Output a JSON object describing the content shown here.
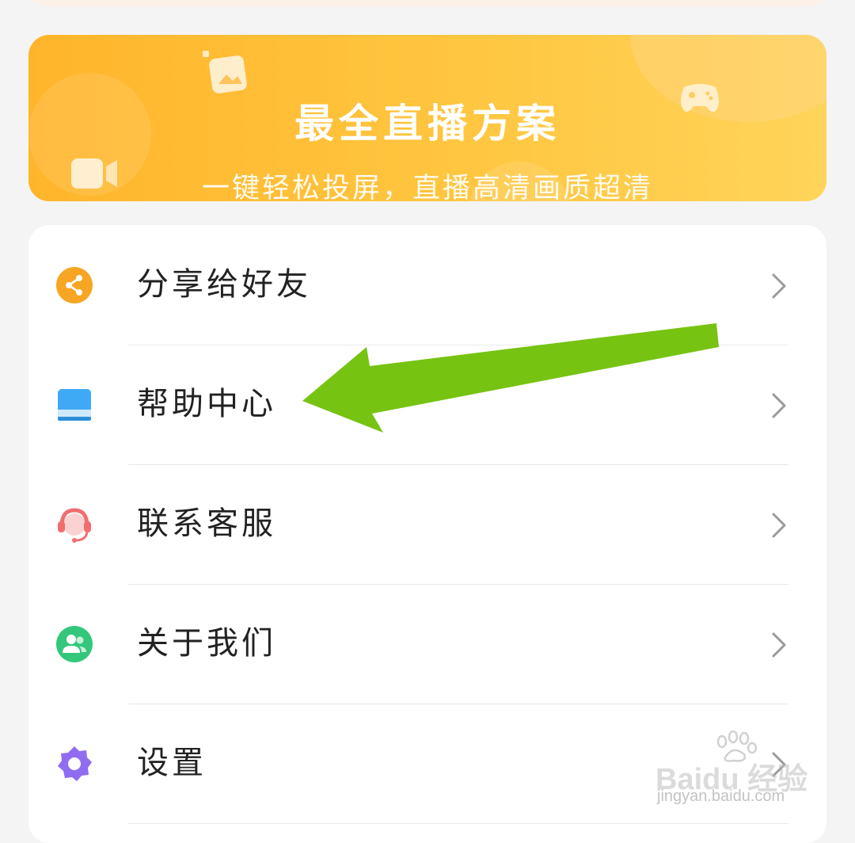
{
  "banner": {
    "title": "最全直播方案",
    "subtitle": "一键轻松投屏，直播高清画质超清"
  },
  "menu": {
    "items": [
      {
        "label": "分享给好友",
        "icon": "share-icon",
        "icon_color": "#f6a623"
      },
      {
        "label": "帮助中心",
        "icon": "book-icon",
        "icon_color": "#3fa9f5"
      },
      {
        "label": "联系客服",
        "icon": "headset-icon",
        "icon_color": "#f06e6e"
      },
      {
        "label": "关于我们",
        "icon": "people-icon",
        "icon_color": "#34c77b"
      },
      {
        "label": "设置",
        "icon": "gear-icon",
        "icon_color": "#8f6cf0"
      }
    ]
  },
  "annotation": {
    "arrow_color": "#76c312"
  },
  "watermark": {
    "logo": "Baidu 经验",
    "url": "jingyan.baidu.com"
  },
  "colors": {
    "banner_start": "#ffb52b",
    "banner_end": "#ffd45a",
    "background": "#f4f4f4"
  }
}
